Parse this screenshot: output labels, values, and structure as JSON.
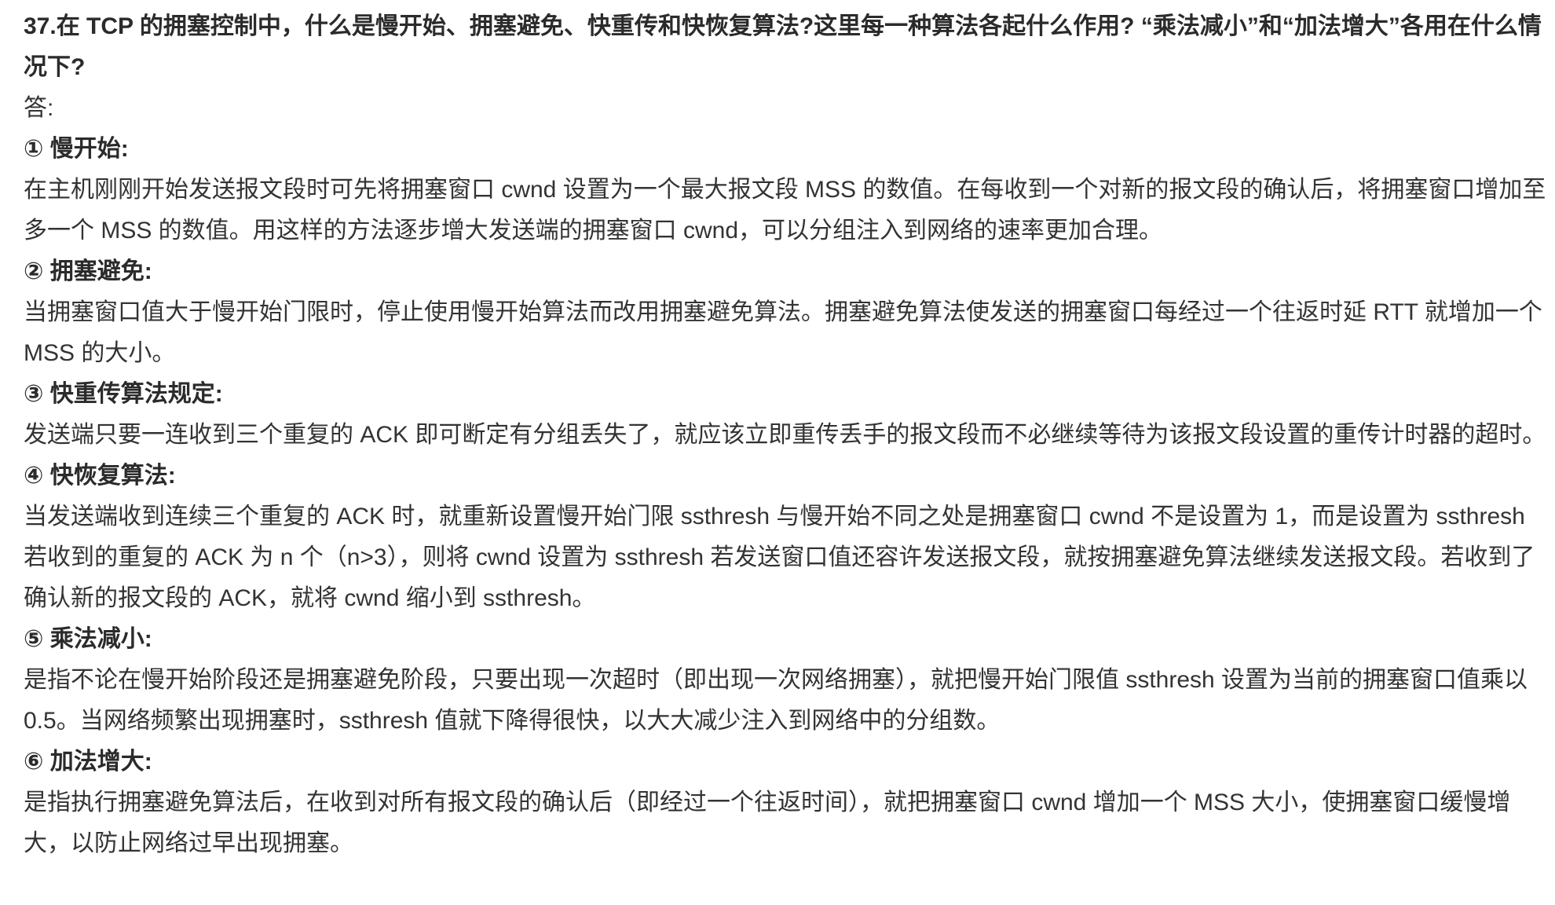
{
  "question": "37.在 TCP 的拥塞控制中，什么是慢开始、拥塞避免、快重传和快恢复算法?这里每一种算法各起什么作用? “乘法减小”和“加法增大”各用在什么情况下?",
  "answer_label": "答:",
  "sections": [
    {
      "heading": "① 慢开始:",
      "body": "在主机刚刚开始发送报文段时可先将拥塞窗口 cwnd 设置为一个最大报文段 MSS 的数值。在每收到一个对新的报文段的确认后，将拥塞窗口增加至多一个 MSS 的数值。用这样的方法逐步增大发送端的拥塞窗口 cwnd，可以分组注入到网络的速率更加合理。"
    },
    {
      "heading": "② 拥塞避免:",
      "body": "当拥塞窗口值大于慢开始门限时，停止使用慢开始算法而改用拥塞避免算法。拥塞避免算法使发送的拥塞窗口每经过一个往返时延 RTT 就增加一个 MSS 的大小。"
    },
    {
      "heading": "③ 快重传算法规定:",
      "body": "发送端只要一连收到三个重复的 ACK 即可断定有分组丢失了，就应该立即重传丢手的报文段而不必继续等待为该报文段设置的重传计时器的超时。"
    },
    {
      "heading": "④ 快恢复算法:",
      "body": "当发送端收到连续三个重复的 ACK 时，就重新设置慢开始门限 ssthresh 与慢开始不同之处是拥塞窗口 cwnd 不是设置为 1，而是设置为 ssthresh 若收到的重复的 ACK 为 n 个（n>3），则将 cwnd 设置为 ssthresh 若发送窗口值还容许发送报文段，就按拥塞避免算法继续发送报文段。若收到了确认新的报文段的 ACK，就将 cwnd 缩小到 ssthresh。"
    },
    {
      "heading": "⑤ 乘法减小:",
      "body": "是指不论在慢开始阶段还是拥塞避免阶段，只要出现一次超时（即出现一次网络拥塞），就把慢开始门限值 ssthresh 设置为当前的拥塞窗口值乘以 0.5。当网络频繁出现拥塞时，ssthresh 值就下降得很快，以大大减少注入到网络中的分组数。"
    },
    {
      "heading": "⑥ 加法增大:",
      "body": "是指执行拥塞避免算法后，在收到对所有报文段的确认后（即经过一个往返时间），就把拥塞窗口 cwnd 增加一个 MSS 大小，使拥塞窗口缓慢增大，以防止网络过早出现拥塞。"
    }
  ]
}
